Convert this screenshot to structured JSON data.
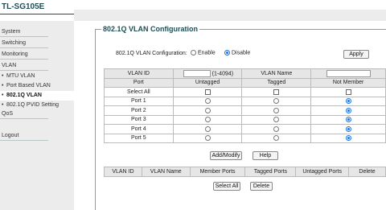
{
  "app": {
    "title": "TL-SG105E"
  },
  "sidebar": {
    "items": [
      {
        "label": "System"
      },
      {
        "label": "Switching"
      },
      {
        "label": "Monitoring"
      },
      {
        "label": "VLAN"
      },
      {
        "label": "MTU VLAN"
      },
      {
        "label": "Port Based VLAN"
      },
      {
        "label": "802.1Q VLAN"
      },
      {
        "label": "802.1Q PVID Setting"
      },
      {
        "label": "QoS"
      },
      {
        "label": "Logout"
      }
    ],
    "bullet": "•"
  },
  "main": {
    "section_title": "802.1Q VLAN Configuration",
    "config_label": "802.1Q VLAN Configuration:",
    "enable_label": "Enable",
    "disable_label": "Disable",
    "apply_label": "Apply",
    "vlan_id_label": "VLAN ID",
    "vlan_id_range": "(1-4094)",
    "vlan_id_value": "",
    "vlan_name_label": "VLAN Name",
    "vlan_name_value": "",
    "columns": {
      "port": "Port",
      "untagged": "Untagged",
      "tagged": "Tagged",
      "not_member": "Not Member"
    },
    "select_all_label": "Select All",
    "ports": [
      {
        "name": "Port 1",
        "selected": "not_member"
      },
      {
        "name": "Port 2",
        "selected": "not_member"
      },
      {
        "name": "Port 3",
        "selected": "not_member"
      },
      {
        "name": "Port 4",
        "selected": "not_member"
      },
      {
        "name": "Port 5",
        "selected": "not_member"
      }
    ],
    "add_modify_label": "Add/Modify",
    "help_label": "Help",
    "list_columns": [
      "VLAN ID",
      "VLAN Name",
      "Member Ports",
      "Tagged Ports",
      "Untagged Ports",
      "Delete"
    ],
    "select_all_button": "Select All",
    "delete_button": "Delete"
  },
  "colors": {
    "brand": "#1c4f55",
    "sidebar_bg": "#ececec",
    "radio_on": "#1a73e8"
  }
}
